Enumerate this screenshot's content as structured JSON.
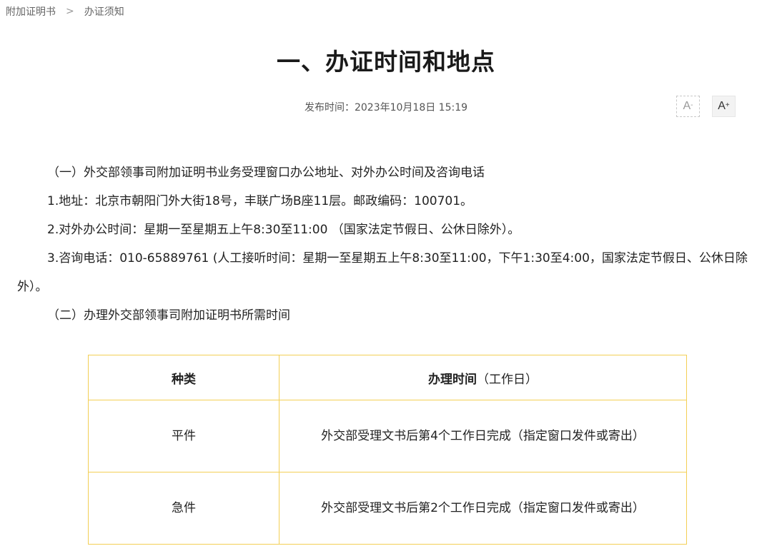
{
  "breadcrumb": {
    "items": [
      "附加证明书",
      "办证须知"
    ],
    "separator": ">"
  },
  "title": "一、办证时间和地点",
  "publish": {
    "label": "发布时间：",
    "value": "2023年10月18日  15:19"
  },
  "font_controls": {
    "decrease": "A",
    "decrease_sign": "-",
    "increase": "A",
    "increase_sign": "+"
  },
  "paragraphs": [
    "（一）外交部领事司附加证明书业务受理窗口办公地址、对外办公时间及咨询电话",
    "1.地址：北京市朝阳门外大街18号，丰联广场B座11层。邮政编码：100701。",
    "2.对外办公时间：星期一至星期五上午8:30至11:00 （国家法定节假日、公休日除外）。",
    "3.咨询电话：010-65889761 (人工接听时间：星期一至星期五上午8:30至11:00，下午1:30至4:00，国家法定节假日、公休日除外）。",
    "（二）办理外交部领事司附加证明书所需时间"
  ],
  "table": {
    "headers": [
      "种类",
      "办理时间",
      "（工作日）"
    ],
    "rows": [
      [
        "平件",
        "外交部受理文书后第4个工作日完成（指定窗口发件或寄出）"
      ],
      [
        "急件",
        "外交部受理文书后第2个工作日完成（指定窗口发件或寄出）"
      ]
    ]
  },
  "colors": {
    "table_border": "#f3cf55",
    "text": "#222222"
  }
}
